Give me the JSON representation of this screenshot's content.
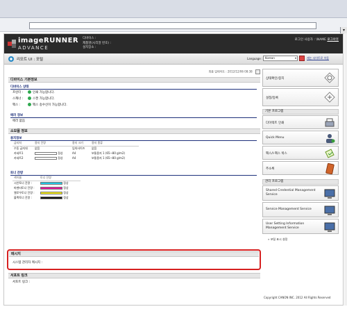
{
  "browser": {
    "address_value": ""
  },
  "header": {
    "brand_line1": "imageRUNNER",
    "brand_line2": "ADVANCE",
    "device_name_label": "디바이스 :",
    "product_name_label": "제품명(시리얼 번호) :",
    "location_label": "설치장소 :",
    "login_user_label": "로그인 사용자 :",
    "login_user_value": "\\NAME",
    "logout_label": "로그아웃"
  },
  "subheader": {
    "title": "리모트 UI : 포털",
    "language_label": "Language :",
    "language_value": "Korean",
    "site_link": "캐논 사이트로 이동"
  },
  "main": {
    "last_updated": "최종 업데이트 : 2012/12/06 08:38",
    "basic_info": {
      "title": "디바이스 기본정보",
      "device_status": {
        "title": "디바이스 상태",
        "rows": [
          {
            "label": "프린터 :",
            "text": "인쇄 가능합니다."
          },
          {
            "label": "스캐너 :",
            "text": "스캔 가능합니다."
          },
          {
            "label": "팩스 :",
            "text": "팩스 송수신이 가능합니다."
          }
        ]
      },
      "error_info": {
        "title": "에러 정보",
        "text": "에러 없음"
      }
    },
    "consumables": {
      "title": "소모품 정보",
      "paper": {
        "title": "용지정보",
        "headers": [
          "급지처",
          "용지 잔량",
          "용지 크기",
          "용지 종류"
        ],
        "rows": [
          {
            "source": "수동 급지대",
            "remaining": "없음",
            "size": "임의사이즈",
            "type": "없음"
          },
          {
            "source": "카세트1",
            "remaining": "정상",
            "size": "A4",
            "type": "보통용지 1 (65~80 g/m2)"
          },
          {
            "source": "카세트2",
            "remaining": "정상",
            "size": "A4",
            "type": "보통용지 1 (65~80 g/m2)"
          }
        ]
      },
      "toner": {
        "title": "토너 잔량",
        "headers": [
          "색이름",
          "토너 잔량"
        ],
        "rows": [
          {
            "name": "시안토너 잔량 :",
            "color": "#22c8e6",
            "status": "정상"
          },
          {
            "name": "마젠타토너 잔량 :",
            "color": "#e6159b",
            "status": "정상"
          },
          {
            "name": "옐로우토너 잔량 :",
            "color": "#f5ea14",
            "status": "정상"
          },
          {
            "name": "블랙토너 잔량 :",
            "color": "#111111",
            "status": "정상"
          }
        ]
      }
    },
    "message": {
      "title": "메시지",
      "text": "시스템 관리자 메시지 :"
    },
    "support": {
      "title": "서포트 링크",
      "text": "서포트 링크 :"
    }
  },
  "side": {
    "top_buttons": [
      {
        "label": "상태확인/중지",
        "icon": "status-monitor-icon"
      },
      {
        "label": "설정/등록",
        "icon": "settings-icon"
      }
    ],
    "basic_functions_title": "기본 프로그램",
    "basic_buttons": [
      {
        "label": "다이렉트 인쇄",
        "icon": "printer-icon"
      },
      {
        "label": "Quick Menu",
        "icon": "user-icon"
      },
      {
        "label": "팩스/I-팩스 박스",
        "icon": "fax-box-icon"
      },
      {
        "label": "주소록",
        "icon": "address-book-icon"
      }
    ],
    "service_title": "관리 프로그램",
    "service_buttons": [
      {
        "label": "Shared Credential Management Service",
        "icon": "monitor-icon"
      },
      {
        "label": "Service Management Service",
        "icon": "monitor-icon"
      },
      {
        "label": "User Setting Information Management Service",
        "icon": "monitor-icon"
      }
    ],
    "shortcut_link": "포털 표시 설정",
    "copyright": "Copyright CANON INC. 2012 All Rights Reserved"
  }
}
